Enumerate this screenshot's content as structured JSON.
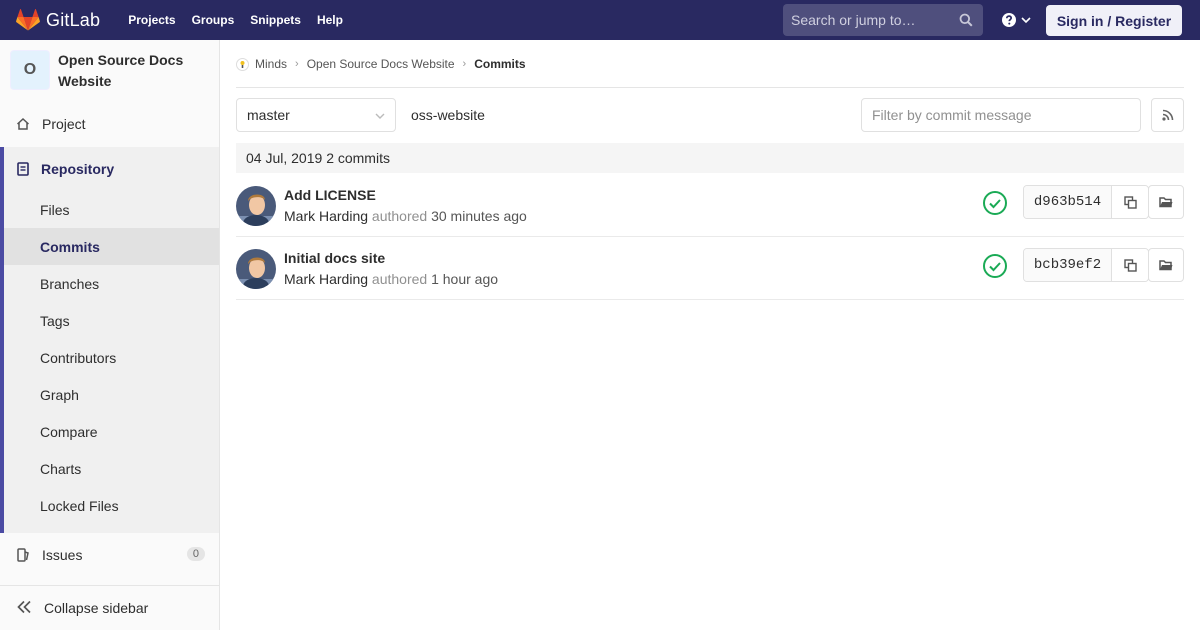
{
  "navbar": {
    "brand": "GitLab",
    "links": [
      "Projects",
      "Groups",
      "Snippets",
      "Help"
    ],
    "search_placeholder": "Search or jump to…",
    "signin_label": "Sign in / Register",
    "icons": {
      "logo": "gitlab-tanuki-icon",
      "search": "search-icon",
      "help": "question-circle-icon",
      "caret": "chevron-down-icon"
    }
  },
  "sidebar": {
    "project_initial": "O",
    "project_name": "Open Source Docs Website",
    "project_label": "Project",
    "repository_label": "Repository",
    "repository_items": [
      "Files",
      "Commits",
      "Branches",
      "Tags",
      "Contributors",
      "Graph",
      "Compare",
      "Charts",
      "Locked Files"
    ],
    "active_item": "Commits",
    "issues_label": "Issues",
    "issues_count": "0",
    "collapse_label": "Collapse sidebar"
  },
  "breadcrumb": {
    "group": "Minds",
    "project": "Open Source Docs Website",
    "current": "Commits"
  },
  "toolbar": {
    "branch": "master",
    "path": "oss-website",
    "filter_placeholder": "Filter by commit message"
  },
  "commits_day": {
    "date": "04 Jul, 2019",
    "count_label": "2 commits"
  },
  "commits": [
    {
      "title": "Add LICENSE",
      "author": "Mark Harding",
      "verb": "authored",
      "time": "30 minutes ago",
      "sha": "d963b514",
      "status": "success"
    },
    {
      "title": "Initial docs site",
      "author": "Mark Harding",
      "verb": "authored",
      "time": "1 hour ago",
      "sha": "bcb39ef2",
      "status": "success"
    }
  ],
  "colors": {
    "navbar": "#292961",
    "accent": "#4b4ba3",
    "success": "#1aaa55"
  }
}
